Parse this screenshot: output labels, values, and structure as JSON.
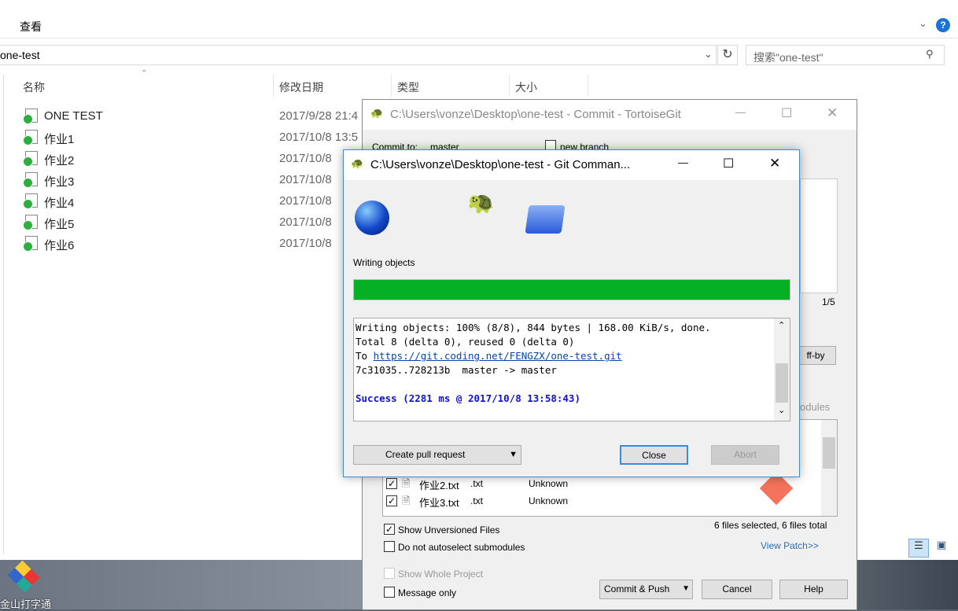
{
  "explorer": {
    "menu_view": "查看",
    "address": "one-test",
    "search_placeholder": "搜索\"one-test\"",
    "columns": {
      "name": "名称",
      "date": "修改日期",
      "type": "类型",
      "size": "大小"
    },
    "files": [
      {
        "name": "ONE TEST",
        "date": "2017/9/28 21:4"
      },
      {
        "name": "作业1",
        "date": "2017/10/8 13:5"
      },
      {
        "name": "作业2",
        "date": "2017/10/8"
      },
      {
        "name": "作业3",
        "date": "2017/10/8"
      },
      {
        "name": "作业4",
        "date": "2017/10/8"
      },
      {
        "name": "作业5",
        "date": "2017/10/8"
      },
      {
        "name": "作业6",
        "date": "2017/10/8"
      }
    ]
  },
  "desktop": {
    "icon_label": "金山打字通"
  },
  "commit": {
    "title": "C:\\Users\\vonze\\Desktop\\one-test - Commit - TortoiseGit",
    "commit_to_label": "Commit to:",
    "branch": "master",
    "new_branch": "new branch",
    "page": "1/5",
    "signoff": "ff-by",
    "submodules": "odules",
    "rows": [
      {
        "name": "作业2.txt",
        "ext": ".txt",
        "status": "Unknown"
      },
      {
        "name": "作业3.txt",
        "ext": ".txt",
        "status": "Unknown"
      }
    ],
    "show_unversioned": "Show Unversioned Files",
    "no_autoselect": "Do not autoselect submodules",
    "file_count": "6 files selected, 6 files total",
    "view_patch": "View Patch>>",
    "show_whole": "Show Whole Project",
    "message_only": "Message only",
    "commit_push": "Commit & Push",
    "cancel": "Cancel",
    "help": "Help"
  },
  "git": {
    "title": "C:\\Users\\vonze\\Desktop\\one-test - Git Comman...",
    "status": "Writing objects",
    "progress": 100,
    "progress_color": "#06b025",
    "log": [
      "Writing objects: 100% (8/8), 844 bytes | 168.00 KiB/s, done.",
      "Total 8 (delta 0), reused 0 (delta 0)",
      "7c31035..728213b  master -> master"
    ],
    "to_prefix": "To ",
    "url": "https://git.coding.net/FENGZX/one-test.git",
    "success": "Success (2281 ms @ 2017/10/8 13:58:43)",
    "create_pr": "Create pull request",
    "close": "Close",
    "abort": "Abort"
  }
}
